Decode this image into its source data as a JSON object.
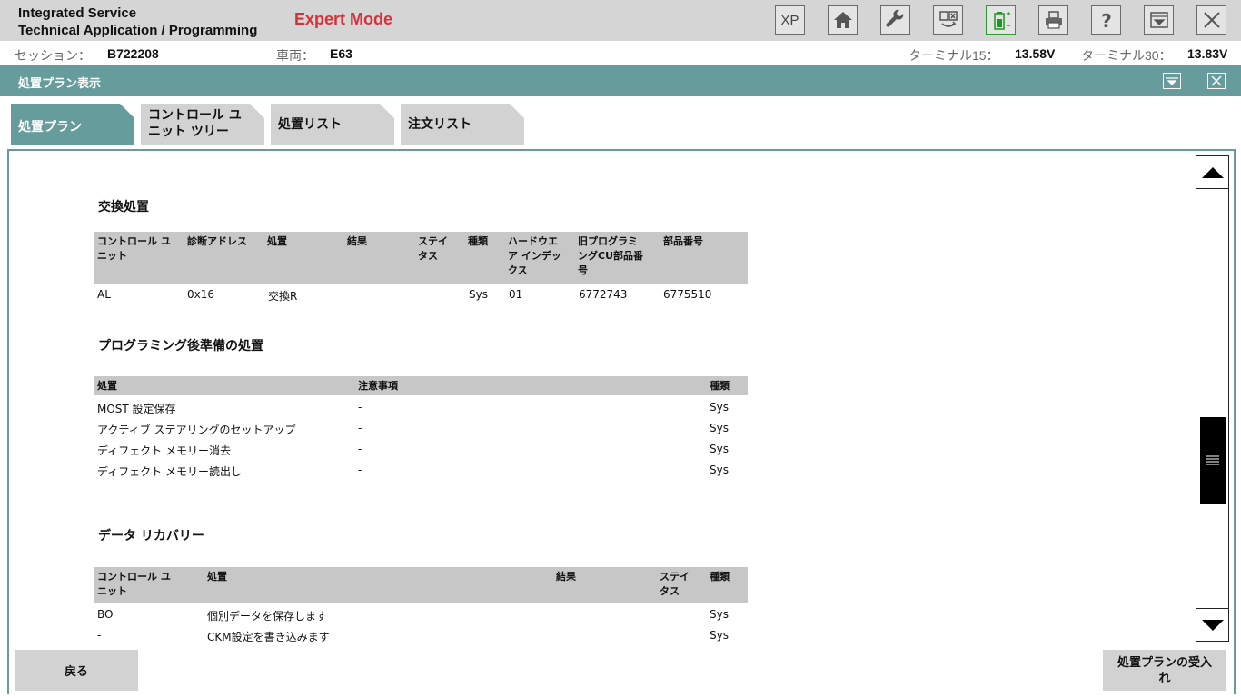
{
  "app": {
    "title_line1": "Integrated Service",
    "title_line2": "Technical Application / Programming",
    "mode": "Expert Mode",
    "xp_label": "XP"
  },
  "toolbar": {
    "icons": [
      "xp-icon",
      "home-icon",
      "wrench-icon",
      "transfer-icon",
      "battery-icon",
      "printer-icon",
      "help-icon",
      "panel-icon",
      "close-icon"
    ]
  },
  "info": {
    "session_label": "セッション：",
    "session_value": "B722208",
    "vehicle_label": "車両：",
    "vehicle_value": "E63",
    "t15_label": "ターミナル15：",
    "t15_value": "13.58V",
    "t30_label": "ターミナル30：",
    "t30_value": "13.83V"
  },
  "section": {
    "title": "処置プラン表示"
  },
  "tabs": [
    {
      "label": "処置プラン"
    },
    {
      "label_line1": "コントロール ユ",
      "label_line2": "ニット ツリー"
    },
    {
      "label": "処置リスト"
    },
    {
      "label": "注文リスト"
    }
  ],
  "replacement": {
    "heading": "交換処置",
    "headers": {
      "cu_1": "コントロール ユ",
      "cu_2": "ニット",
      "addr": "診断アドレス",
      "action": "処置",
      "result": "結果",
      "status_1": "ステイ",
      "status_2": "タス",
      "type": "種類",
      "hw_1": "ハードウエ",
      "hw_2": "ア インデッ",
      "hw_3": "クス",
      "old_1": "旧プログラミ",
      "old_2": "ングCU部品番",
      "old_3": "号",
      "part": "部品番号"
    },
    "rows": [
      {
        "cu": "AL",
        "addr": "0x16",
        "action": "交換R",
        "result": "",
        "status": "",
        "type": "Sys",
        "hw": "01",
        "old": "6772743",
        "part": "6775510"
      }
    ]
  },
  "post_programming": {
    "heading": "プログラミング後準備の処置",
    "headers": {
      "action": "処置",
      "note": "注意事項",
      "type": "種類"
    },
    "rows": [
      {
        "action": "MOST 設定保存",
        "note": "-",
        "type": "Sys"
      },
      {
        "action": "アクティブ ステアリングのセットアップ",
        "note": "-",
        "type": "Sys"
      },
      {
        "action": "ディフェクト メモリー消去",
        "note": "-",
        "type": "Sys"
      },
      {
        "action": "ディフェクト メモリー読出し",
        "note": "-",
        "type": "Sys"
      }
    ]
  },
  "data_recovery": {
    "heading": "データ リカバリー",
    "headers": {
      "cu_1": "コントロール ユ",
      "cu_2": "ニット",
      "action": "処置",
      "result": "結果",
      "status_1": "ステイ",
      "status_2": "タス",
      "type": "種類"
    },
    "rows": [
      {
        "cu": "BO",
        "action": "個別データを保存します",
        "type": "Sys"
      },
      {
        "cu": "-",
        "action": "CKM設定を書き込みます",
        "type": "Sys"
      }
    ]
  },
  "buttons": {
    "back": "戻る",
    "accept_line1": "処置プランの受入",
    "accept_line2": "れ"
  }
}
